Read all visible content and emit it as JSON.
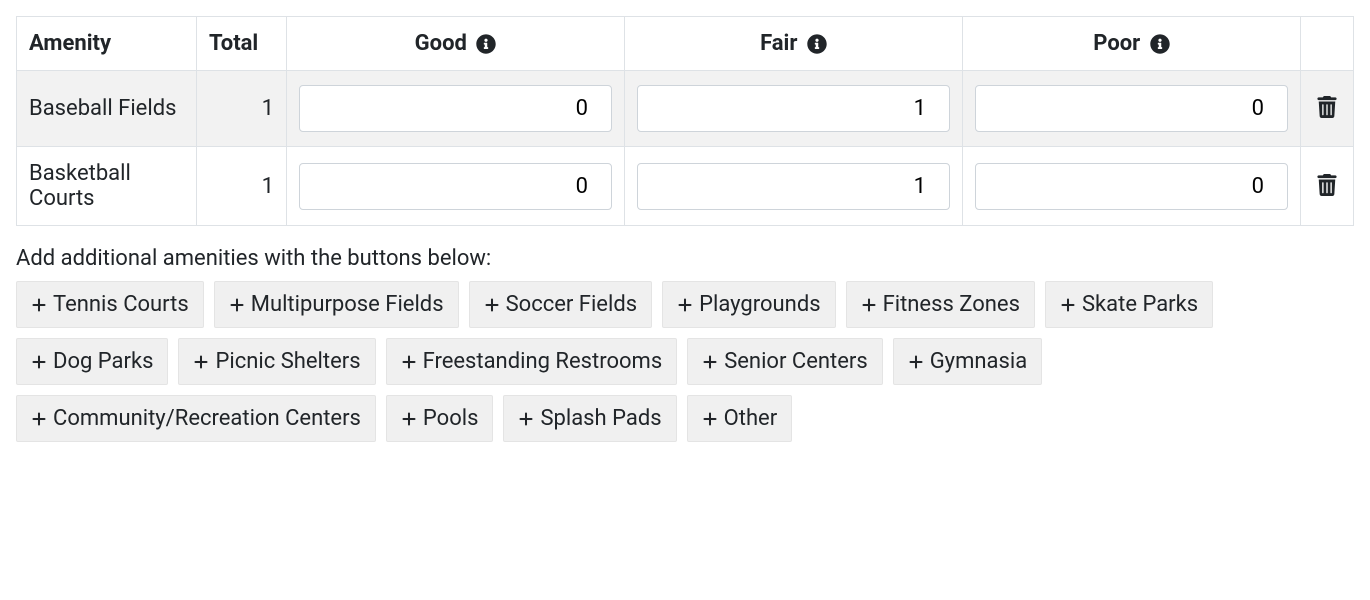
{
  "table": {
    "headers": {
      "amenity": "Amenity",
      "total": "Total",
      "good": "Good",
      "fair": "Fair",
      "poor": "Poor"
    },
    "rows": [
      {
        "amenity": "Baseball Fields",
        "total": "1",
        "good": "0",
        "fair": "1",
        "poor": "0"
      },
      {
        "amenity": "Basketball Courts",
        "total": "1",
        "good": "0",
        "fair": "1",
        "poor": "0"
      }
    ]
  },
  "helper_text": "Add additional amenities with the buttons below:",
  "add_buttons": [
    "Tennis Courts",
    "Multipurpose Fields",
    "Soccer Fields",
    "Playgrounds",
    "Fitness Zones",
    "Skate Parks",
    "Dog Parks",
    "Picnic Shelters",
    "Freestanding Restrooms",
    "Senior Centers",
    "Gymnasia",
    "Community/Recreation Centers",
    "Pools",
    "Splash Pads",
    "Other"
  ]
}
